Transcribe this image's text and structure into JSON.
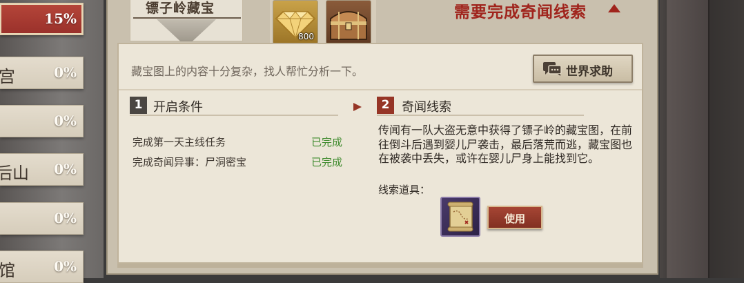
{
  "progress_list": [
    {
      "name": "",
      "percent": "15%",
      "active": true
    },
    {
      "name": "宫",
      "percent": "0%",
      "active": false
    },
    {
      "name": "",
      "percent": "0%",
      "active": false
    },
    {
      "name": "后山",
      "percent": "0%",
      "active": false
    },
    {
      "name": "",
      "percent": "0%",
      "active": false
    },
    {
      "name": "馆",
      "percent": "0%",
      "active": false
    }
  ],
  "header": {
    "title": "镖子岭藏宝",
    "rewards": [
      {
        "icon": "diamond-icon",
        "count": "800"
      },
      {
        "icon": "treasure-chest-icon",
        "count": ""
      }
    ],
    "requirement": "需要完成奇闻线索"
  },
  "hint": "藏宝图上的内容十分复杂，找人帮忙分析一下。",
  "world_help_label": "世界求助",
  "conditions": {
    "number": "1",
    "title": "开启条件",
    "items": [
      {
        "text": "完成第一天主线任务",
        "status": "已完成"
      },
      {
        "text": "完成奇闻异事：尸洞密宝",
        "status": "已完成"
      }
    ]
  },
  "clues": {
    "number": "2",
    "title": "奇闻线索",
    "description": "传闻有一队大盗无意中获得了镖子岭的藏宝图，在前往倒斗后遇到婴儿尸袭击，最后落荒而逃，藏宝图也在被袭中丢失，或许在婴儿尸身上能找到它。",
    "item_label": "线索道具：",
    "item_icon": "treasure-map-scroll-icon",
    "use_label": "使用"
  },
  "colors": {
    "accent_red": "#a0241c",
    "complete_green": "#3d8a2c",
    "active_tab": "#99302a"
  }
}
